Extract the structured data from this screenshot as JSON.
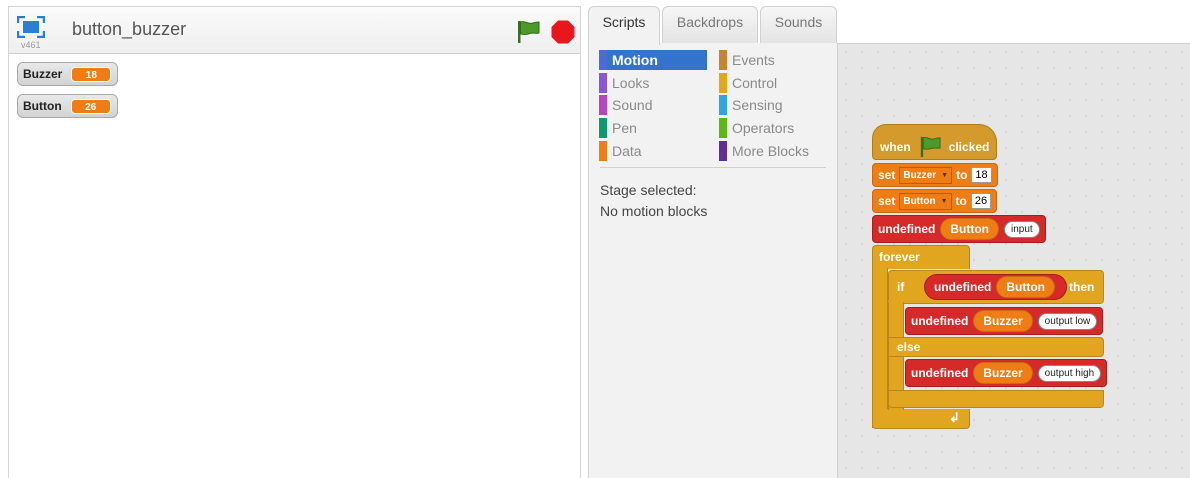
{
  "stage": {
    "project_title": "button_buzzer",
    "version": "v461",
    "watchers": [
      {
        "name": "Buzzer",
        "value": "18"
      },
      {
        "name": "Button",
        "value": "26"
      }
    ]
  },
  "tabs": [
    "Scripts",
    "Backdrops",
    "Sounds"
  ],
  "palette": {
    "categories_left": [
      "Motion",
      "Looks",
      "Sound",
      "Pen",
      "Data"
    ],
    "categories_right": [
      "Events",
      "Control",
      "Sensing",
      "Operators",
      "More Blocks"
    ],
    "colors": {
      "Motion": "#4a6cd4",
      "Looks": "#8a55d7",
      "Sound": "#bb42c3",
      "Pen": "#0e9a6c",
      "Data": "#ee7d16",
      "Events": "#c88330",
      "Control": "#e1a91a",
      "Sensing": "#2ca5e2",
      "Operators": "#5cb712",
      "More Blocks": "#632d99"
    },
    "message_line1": "Stage selected:",
    "message_line2": "No motion blocks"
  },
  "script": {
    "hat_when": "when",
    "hat_clicked": "clicked",
    "set_label": "set",
    "to_label": "to",
    "set1_var": "Buzzer",
    "set1_value": "18",
    "set2_var": "Button",
    "set2_value": "26",
    "undefined_label": "undefined",
    "pin_button": "Button",
    "pin_buzzer": "Buzzer",
    "mode_input": "input",
    "forever_label": "forever",
    "if_label": "if",
    "then_label": "then",
    "else_label": "else",
    "output_low": "output low",
    "output_high": "output high",
    "loop_arrow": "↲"
  }
}
